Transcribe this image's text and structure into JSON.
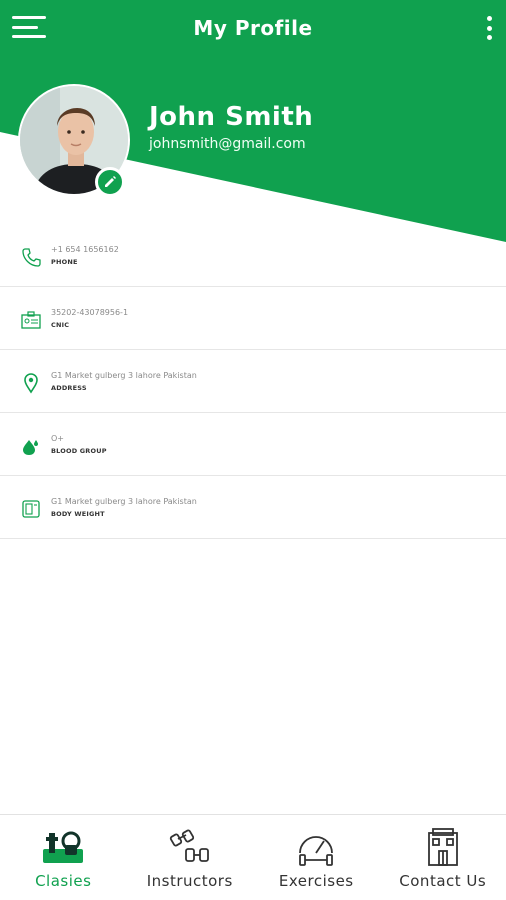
{
  "header": {
    "title": "My Profile"
  },
  "profile": {
    "name": "John Smith",
    "email": "johnsmith@gmail.com"
  },
  "info": [
    {
      "icon": "phone-icon",
      "value": "+1 654 1656162",
      "label": "PHONE"
    },
    {
      "icon": "id-card-icon",
      "value": "35202-43078956-1",
      "label": "CNIC"
    },
    {
      "icon": "location-pin-icon",
      "value": "G1 Market gulberg 3 lahore Pakistan",
      "label": "ADDRESS"
    },
    {
      "icon": "blood-drop-icon",
      "value": "O+",
      "label": "BLOOD GROUP"
    },
    {
      "icon": "scale-icon",
      "value": "G1 Market gulberg 3 lahore Pakistan",
      "label": "BODY WEIGHT"
    }
  ],
  "nav": [
    {
      "icon": "dumbbell-kettlebell-icon",
      "label": "Clasies",
      "active": true
    },
    {
      "icon": "dumbbells-icon",
      "label": "Instructors",
      "active": false
    },
    {
      "icon": "gauge-barbell-icon",
      "label": "Exercises",
      "active": false
    },
    {
      "icon": "building-icon",
      "label": "Contact Us",
      "active": false
    }
  ],
  "colors": {
    "primary": "#10a14f",
    "text": "#333333",
    "muted": "#8a8a8a"
  }
}
